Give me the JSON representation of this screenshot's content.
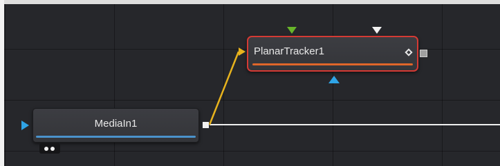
{
  "nodes": {
    "media_in": {
      "title": "MediaIn1",
      "color_bar": "#4a93cc"
    },
    "planar_tracker": {
      "title": "PlanarTracker1",
      "color_bar": "#e0662a",
      "selected_border": "#d53a34"
    }
  },
  "colors": {
    "canvas": "#26272b",
    "wire_output": "#f0f0f0",
    "wire_input": "#e8b31d",
    "input_port": "#2fa4e6",
    "foreground_port": "#68b52a",
    "effect_mask_port": "#f2f2f2"
  },
  "icons": [
    "diamond-icon",
    "view-dots-icon"
  ]
}
